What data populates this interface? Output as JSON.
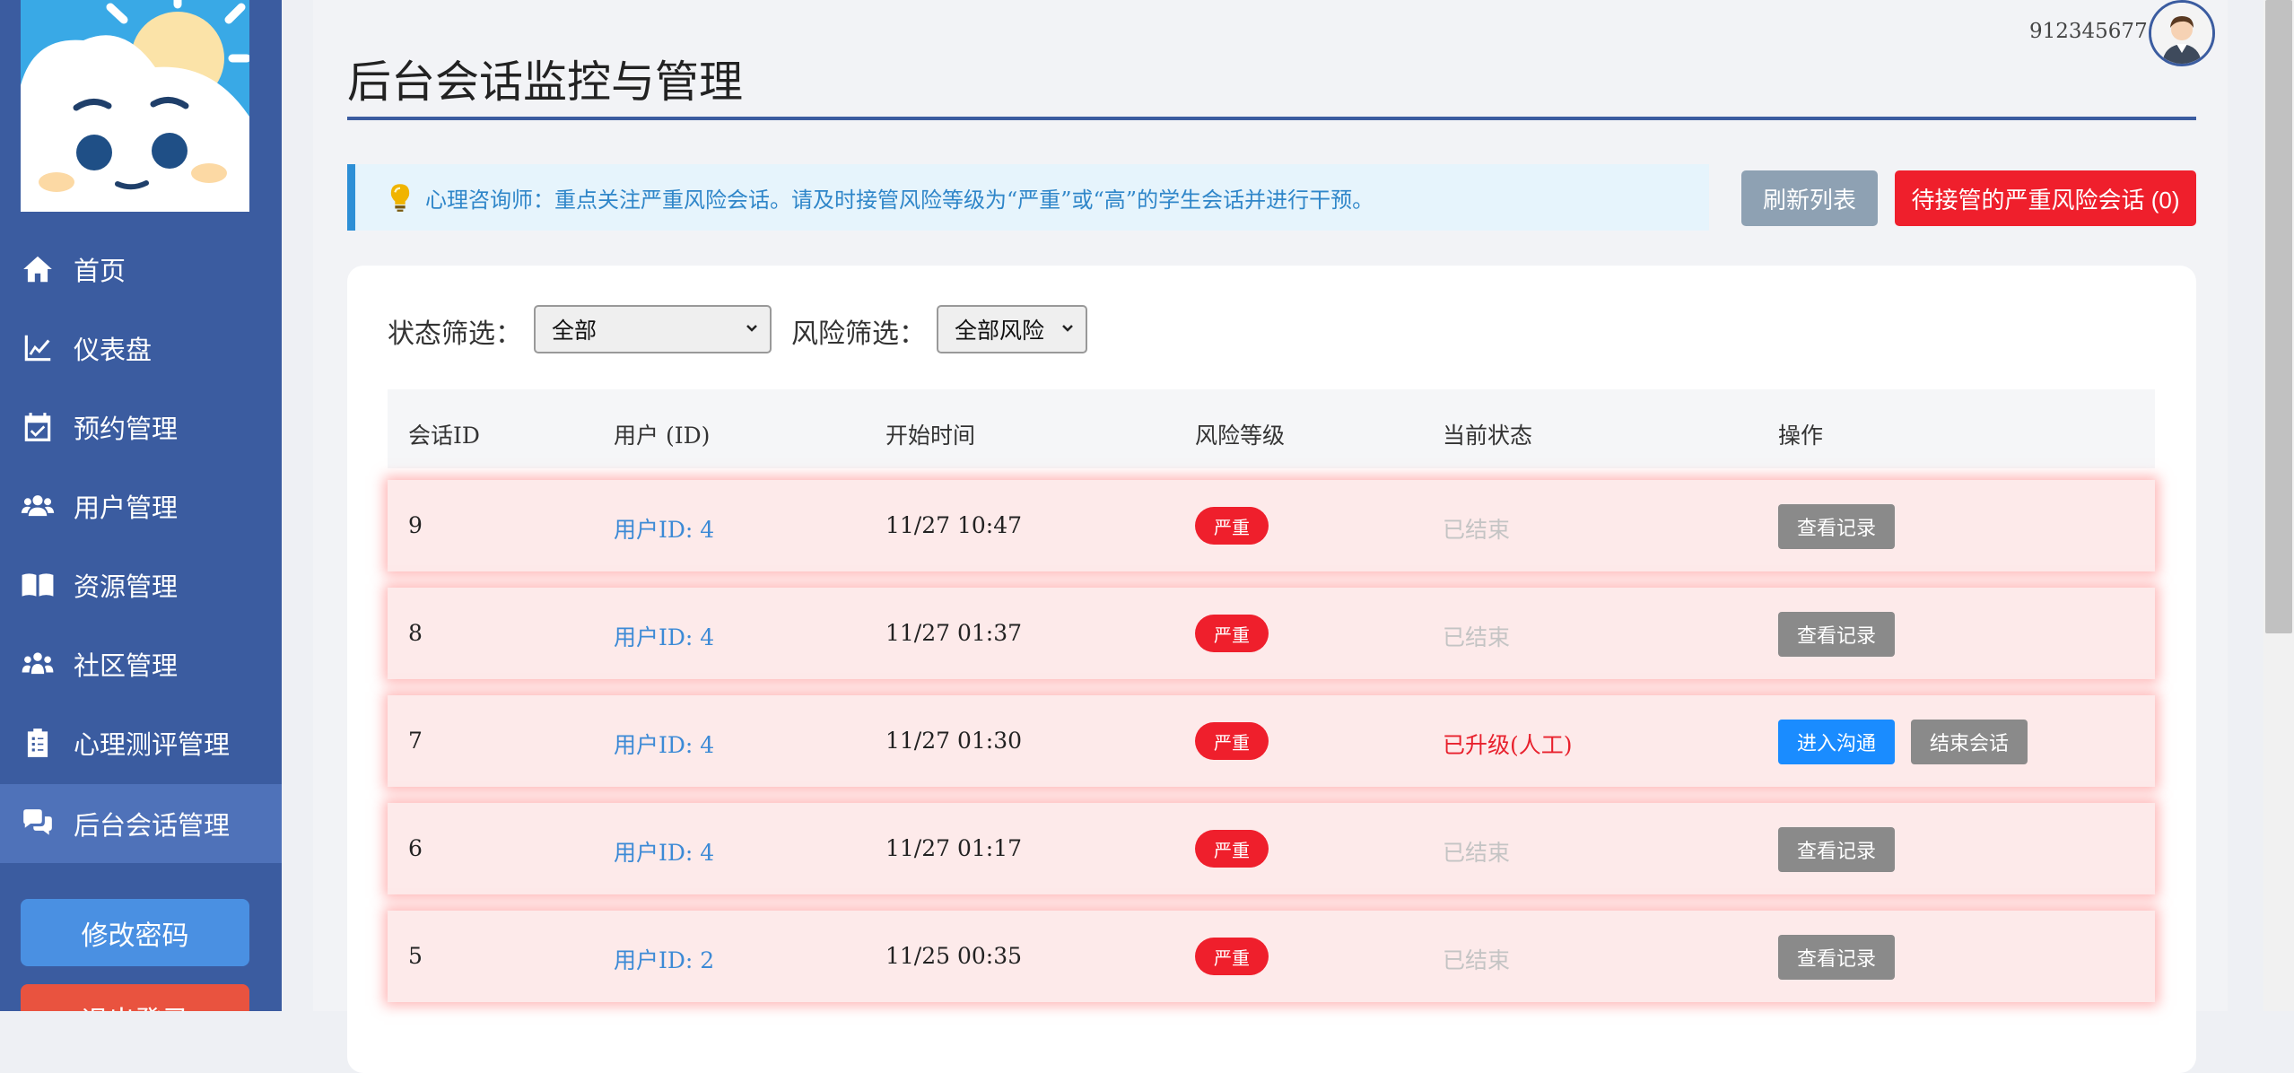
{
  "sidebar": {
    "items": [
      {
        "label": "首页",
        "icon": "home-icon"
      },
      {
        "label": "仪表盘",
        "icon": "chart-line-icon"
      },
      {
        "label": "预约管理",
        "icon": "calendar-check-icon"
      },
      {
        "label": "用户管理",
        "icon": "users-icon"
      },
      {
        "label": "资源管理",
        "icon": "book-icon"
      },
      {
        "label": "社区管理",
        "icon": "community-icon"
      },
      {
        "label": "心理测评管理",
        "icon": "clipboard-icon"
      },
      {
        "label": "后台会话管理",
        "icon": "chat-icon"
      }
    ],
    "active_item": "后台会话管理",
    "change_password": "修改密码",
    "logout": "退出登录"
  },
  "header": {
    "user_id": "912345677"
  },
  "page": {
    "title": "后台会话监控与管理",
    "tip": "心理咨询师：重点关注严重风险会话。请及时接管风险等级为“严重”或“高”的学生会话并进行干预。",
    "refresh_button": "刷新列表",
    "pending_button": "待接管的严重风险会话 (0)"
  },
  "filters": {
    "status_label": "状态筛选：",
    "status_value": "全部",
    "risk_label": "风险筛选：",
    "risk_value": "全部风险"
  },
  "table": {
    "headers": [
      "会话ID",
      "用户 (ID)",
      "开始时间",
      "风险等级",
      "当前状态",
      "操作"
    ],
    "rows": [
      {
        "id": "9",
        "user": "用户ID: 4",
        "start": "11/27 10:47",
        "risk": "严重",
        "status": "已结束",
        "actions": [
          "查看记录"
        ]
      },
      {
        "id": "8",
        "user": "用户ID: 4",
        "start": "11/27 01:37",
        "risk": "严重",
        "status": "已结束",
        "actions": [
          "查看记录"
        ]
      },
      {
        "id": "7",
        "user": "用户ID: 4",
        "start": "11/27 01:30",
        "risk": "严重",
        "status": "已升级(人工)",
        "actions": [
          "进入沟通",
          "结束会话"
        ]
      },
      {
        "id": "6",
        "user": "用户ID: 4",
        "start": "11/27 01:17",
        "risk": "严重",
        "status": "已结束",
        "actions": [
          "查看记录"
        ]
      },
      {
        "id": "5",
        "user": "用户ID: 2",
        "start": "11/25 00:35",
        "risk": "严重",
        "status": "已结束",
        "actions": [
          "查看记录"
        ]
      }
    ]
  },
  "colors": {
    "sidebar": "#3b5ca0",
    "sidebar_active": "#4f72b9",
    "danger": "#ef1f2c",
    "primary": "#1a8cff",
    "gray_button": "#8a8a8a",
    "link": "#3c8ad6"
  }
}
